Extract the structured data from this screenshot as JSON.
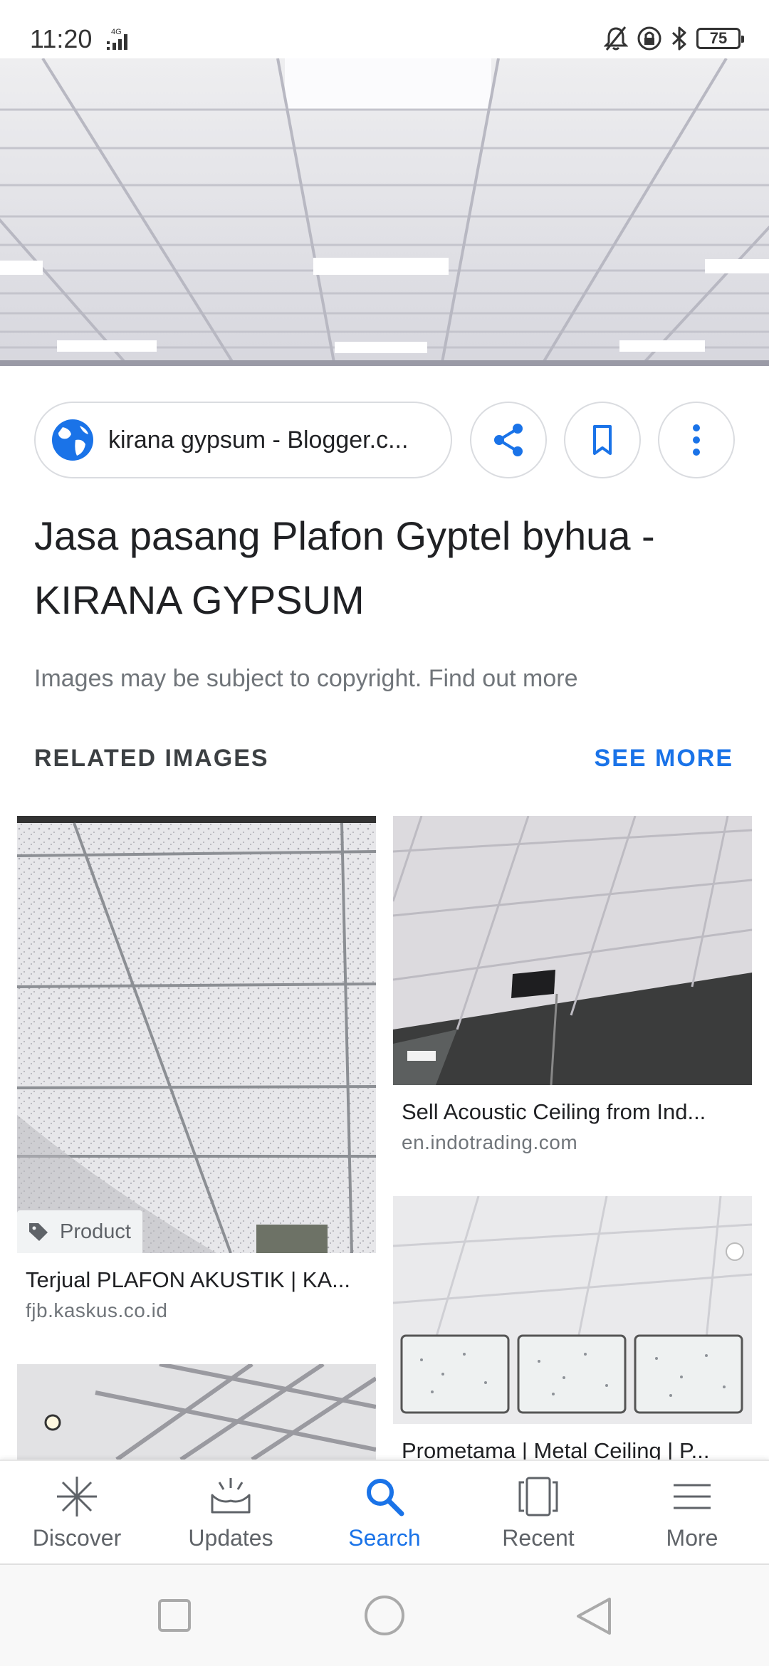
{
  "status_bar": {
    "time": "11:20",
    "network": "4G",
    "battery": "75",
    "icons": [
      "bell-off-icon",
      "rotation-lock-icon",
      "bluetooth-icon",
      "battery-icon"
    ]
  },
  "result": {
    "source": "kirana gypsum - Blogger.c...",
    "title": "Jasa pasang Plafon Gyptel byhua - KIRANA GYPSUM",
    "copyright": "Images may be subject to copyright. Find out more",
    "actions": [
      "share-icon",
      "bookmark-icon",
      "more-vert-icon"
    ]
  },
  "related": {
    "heading": "RELATED IMAGES",
    "see_more": "SEE MORE",
    "items": [
      {
        "title": "Terjual PLAFON AKUSTIK | KA...",
        "domain": "fjb.kaskus.co.id",
        "badge": "Product"
      },
      {
        "title": "Sell Acoustic Ceiling from Ind...",
        "domain": "en.indotrading.com"
      },
      {
        "title": "Prometama | Metal Ceiling | P..."
      }
    ]
  },
  "bottom_nav": {
    "items": [
      {
        "label": "Discover",
        "icon": "discover-icon"
      },
      {
        "label": "Updates",
        "icon": "updates-icon"
      },
      {
        "label": "Search",
        "icon": "search-icon",
        "active": true
      },
      {
        "label": "Recent",
        "icon": "recent-icon"
      },
      {
        "label": "More",
        "icon": "menu-icon"
      }
    ]
  },
  "colors": {
    "accent": "#1a73e8",
    "text": "#202124",
    "muted": "#70757a"
  }
}
